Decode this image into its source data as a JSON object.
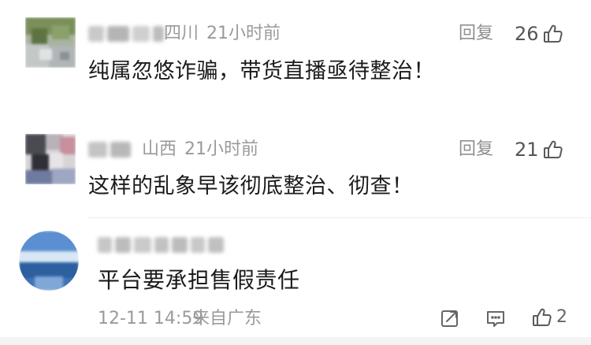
{
  "comments": [
    {
      "region": "四川",
      "time": "21小时前",
      "reply_label": "回复",
      "likes": "26",
      "text": "纯属忽悠诈骗，带货直播亟待整治！"
    },
    {
      "region": "山西",
      "time": "21小时前",
      "reply_label": "回复",
      "likes": "21",
      "text": "这样的乱象早该彻底整治、彻查！"
    },
    {
      "text": "平台要承担售假责任",
      "datetime": "12-11 14:59",
      "source": "来自广东",
      "likes": "2"
    }
  ],
  "icons": {
    "like": "thumbs-up-icon",
    "share": "share-icon",
    "comment": "comment-icon"
  },
  "colors": {
    "meta_gray": "#9a9a9a",
    "text_black": "#1b1b1b",
    "icon_gray": "#666666"
  }
}
